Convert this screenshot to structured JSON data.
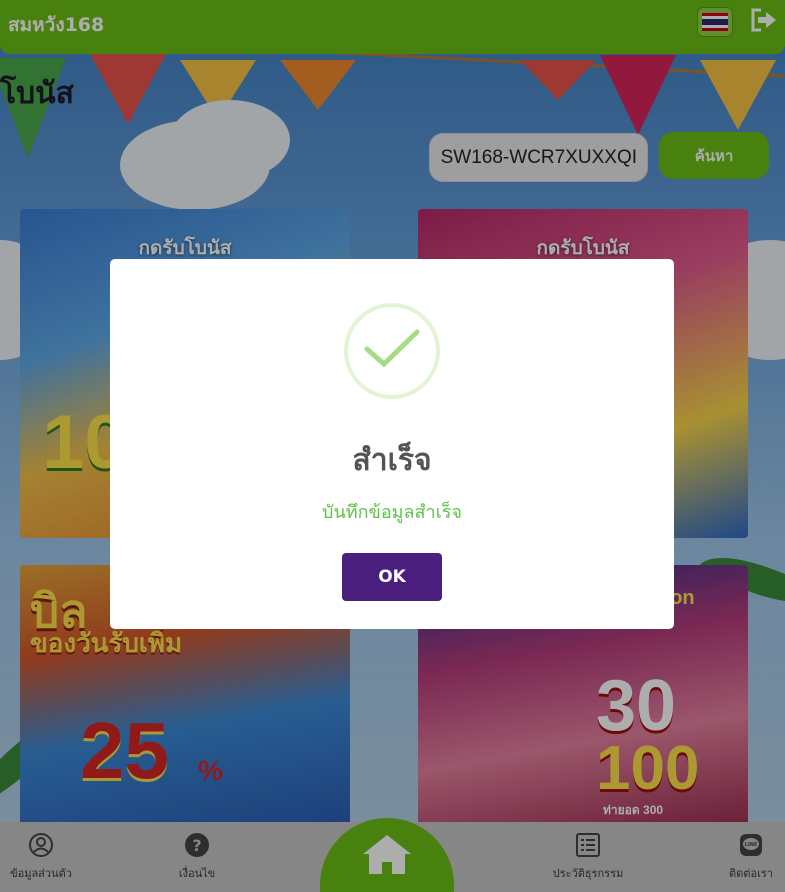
{
  "header": {
    "brand": "สมหวัง168",
    "language_flag": "thai-flag-icon",
    "logout_icon": "logout-icon"
  },
  "page": {
    "title": "โบนัส"
  },
  "search": {
    "value": "SW168-WCR7XUXXQI",
    "button_label": "ค้นหา"
  },
  "promos": [
    {
      "caption": "กดรับโบนัส"
    },
    {
      "caption": "กดรับโบนัส"
    },
    {
      "caption": ""
    },
    {
      "caption": ""
    }
  ],
  "promo_art": {
    "c1_big": "10",
    "c2_big": "",
    "c3_headline": "บิล",
    "c3_sub": "ของวันรับเพิ่ม",
    "c3_big": "25",
    "c3_pct": "%",
    "c4_top": "motion",
    "c4_big1": "30",
    "c4_big2": "100",
    "c4_note": "ท่ายอด 300"
  },
  "modal": {
    "icon": "success-check-icon",
    "title": "สำเร็จ",
    "message": "บันทึกข้อมูลสำเร็จ",
    "ok_label": "OK"
  },
  "bottom_nav": {
    "items": [
      {
        "label": "ข้อมูลส่วนตัว",
        "icon": "user-icon"
      },
      {
        "label": "เงื่อนไข",
        "icon": "help-icon"
      },
      {
        "label": "ประวัติธุรกรรม",
        "icon": "history-list-icon"
      },
      {
        "label": "ติดต่อเรา",
        "icon": "line-chat-icon"
      }
    ],
    "home_icon": "home-icon"
  },
  "colors": {
    "brand_green": "#6cbf15",
    "ok_purple": "#4a1f7e",
    "success_green": "#5ec24a"
  }
}
